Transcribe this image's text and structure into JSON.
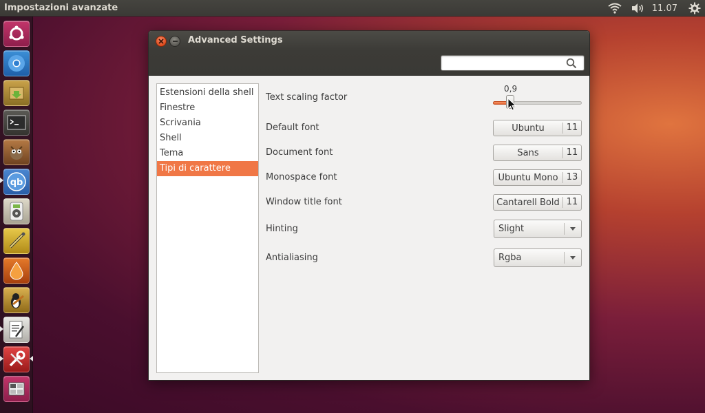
{
  "top_panel": {
    "app_title": "Impostazioni avanzate",
    "clock": "11.07"
  },
  "window": {
    "title": "Advanced Settings",
    "search": {
      "value": "",
      "placeholder": ""
    }
  },
  "sidebar": {
    "items": [
      {
        "label": "Estensioni della shell",
        "selected": false
      },
      {
        "label": "Finestre",
        "selected": false
      },
      {
        "label": "Scrivania",
        "selected": false
      },
      {
        "label": "Shell",
        "selected": false
      },
      {
        "label": "Tema",
        "selected": false
      },
      {
        "label": "Tipi di carattere",
        "selected": true
      }
    ]
  },
  "settings": {
    "text_scaling": {
      "label": "Text scaling factor",
      "value_text": "0,9",
      "value": 0.9,
      "min": 0.5,
      "max": 3.0
    },
    "default_font": {
      "label": "Default font",
      "name": "Ubuntu",
      "size": "11"
    },
    "document_font": {
      "label": "Document font",
      "name": "Sans",
      "size": "11"
    },
    "monospace_font": {
      "label": "Monospace font",
      "name": "Ubuntu Mono",
      "size": "13"
    },
    "window_title_font": {
      "label": "Window title font",
      "name": "Cantarell Bold",
      "size": "11"
    },
    "hinting": {
      "label": "Hinting",
      "value": "Slight"
    },
    "antialiasing": {
      "label": "Antialiasing",
      "value": "Rgba"
    }
  },
  "colors": {
    "accent": "#f07746",
    "panel": "#3c3b37",
    "window_bg": "#f2f1f0"
  },
  "launcher": {
    "items": [
      {
        "icon": "ubuntu-dash-icon"
      },
      {
        "icon": "chromium-browser-icon"
      },
      {
        "icon": "archive-manager-icon"
      },
      {
        "icon": "terminal-icon"
      },
      {
        "icon": "gimp-icon"
      },
      {
        "icon": "qbittorrent-icon"
      },
      {
        "icon": "audio-player-icon"
      },
      {
        "icon": "audio-cable-app-icon"
      },
      {
        "icon": "drop-app-icon"
      },
      {
        "icon": "tux-guitar-icon"
      },
      {
        "icon": "text-editor-icon"
      },
      {
        "icon": "settings-tools-icon"
      },
      {
        "icon": "workspace-switcher-icon"
      }
    ]
  }
}
